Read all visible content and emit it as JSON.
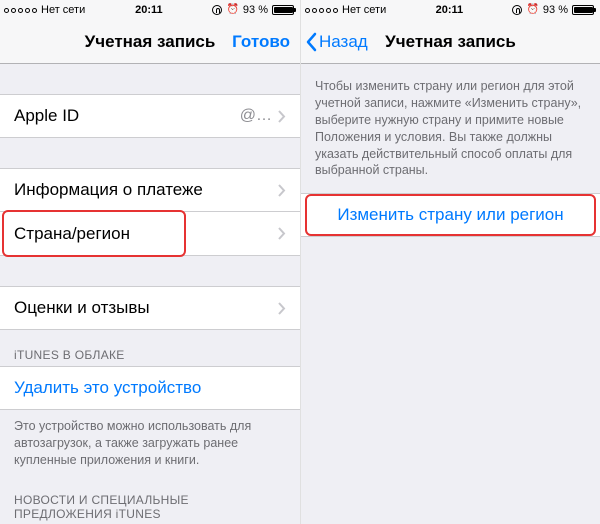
{
  "status": {
    "carrier": "Нет сети",
    "time": "20:11",
    "battery_pct": "93 %"
  },
  "left": {
    "nav": {
      "title": "Учетная запись",
      "done": "Готово"
    },
    "rows": {
      "apple_id_label": "Apple ID",
      "apple_id_value": "@…",
      "payment": "Информация о платеже",
      "country": "Страна/регион",
      "reviews": "Оценки и отзывы"
    },
    "cloud_header": "iTUNES В ОБЛАКЕ",
    "remove_device": "Удалить это устройство",
    "footer": "Это устройство можно использовать для автозагрузок, а также загружать ранее купленные приложения и книги.",
    "news_header": "НОВОСТИ И СПЕЦИАЛЬНЫЕ ПРЕДЛОЖЕНИЯ iTUNES"
  },
  "right": {
    "nav": {
      "back": "Назад",
      "title": "Учетная запись"
    },
    "info": "Чтобы изменить страну или регион для этой учетной записи, нажмите «Изменить страну», выберите нужную страну и примите новые Положения и условия. Вы также должны указать действительный способ оплаты для выбранной страны.",
    "change": "Изменить страну или регион"
  }
}
